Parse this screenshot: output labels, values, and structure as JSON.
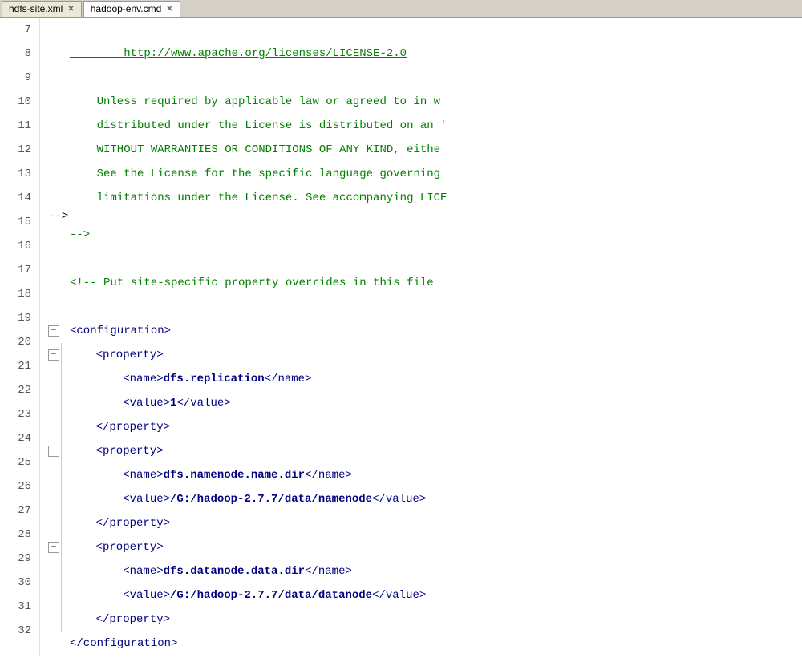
{
  "tabs": [
    {
      "id": "hdfs-site",
      "label": "hdfs-site.xml",
      "active": false,
      "closable": true
    },
    {
      "id": "hadoop-env",
      "label": "hadoop-env.cmd",
      "active": true,
      "closable": true
    }
  ],
  "lines": [
    {
      "num": 7,
      "content": "",
      "type": "empty",
      "indent": 0
    },
    {
      "num": 8,
      "content": "        http://www.apache.org/licenses/LICENSE-2.0",
      "type": "link",
      "indent": 0
    },
    {
      "num": 9,
      "content": "",
      "type": "empty",
      "indent": 0
    },
    {
      "num": 10,
      "content": "    Unless required by applicable law or agreed to in w",
      "type": "comment",
      "indent": 0
    },
    {
      "num": 11,
      "content": "    distributed under the License is distributed on an '",
      "type": "comment",
      "indent": 0
    },
    {
      "num": 12,
      "content": "    WITHOUT WARRANTIES OR CONDITIONS OF ANY KIND, eithe",
      "type": "comment",
      "indent": 0
    },
    {
      "num": 13,
      "content": "    See the License for the specific language governing",
      "type": "comment",
      "indent": 0
    },
    {
      "num": 14,
      "content": "    limitations under the License. See accompanying LICE",
      "type": "comment",
      "indent": 0
    },
    {
      "num": 15,
      "content": "-->",
      "type": "comment",
      "indent": 0
    },
    {
      "num": 16,
      "content": "",
      "type": "empty",
      "indent": 0
    },
    {
      "num": 17,
      "content": "<!-- Put site-specific property overrides in this file",
      "type": "comment",
      "indent": 0
    },
    {
      "num": 18,
      "content": "",
      "type": "empty",
      "indent": 0
    },
    {
      "num": 19,
      "content": "<configuration>",
      "type": "tag-foldable",
      "indent": 0
    },
    {
      "num": 20,
      "content": "    <property>",
      "type": "tag-foldable",
      "indent": 1
    },
    {
      "num": 21,
      "content": "        <name>dfs.replication</name>",
      "type": "tag-with-bold",
      "tag_open": "<name>",
      "bold": "dfs.replication",
      "tag_close": "</name>",
      "indent": 2
    },
    {
      "num": 22,
      "content": "        <value>1</value>",
      "type": "tag-with-bold",
      "tag_open": "<value>",
      "bold": "1",
      "tag_close": "</value>",
      "indent": 2
    },
    {
      "num": 23,
      "content": "    </property>",
      "type": "tag-close",
      "indent": 1
    },
    {
      "num": 24,
      "content": "    <property>",
      "type": "tag-foldable",
      "indent": 1
    },
    {
      "num": 25,
      "content": "        <name>dfs.namenode.name.dir</name>",
      "type": "tag-with-bold",
      "tag_open": "<name>",
      "bold": "dfs.namenode.name.dir",
      "tag_close": "</name>",
      "indent": 2
    },
    {
      "num": 26,
      "content": "        <value>/G:/hadoop-2.7.7/data/namenode</value>",
      "type": "tag-with-bold",
      "tag_open": "<value>",
      "bold": "/G:/hadoop-2.7.7/data/namenode",
      "tag_close": "</value>",
      "indent": 2
    },
    {
      "num": 27,
      "content": "    </property>",
      "type": "tag-close",
      "indent": 1
    },
    {
      "num": 28,
      "content": "    <property>",
      "type": "tag-foldable",
      "indent": 1
    },
    {
      "num": 29,
      "content": "        <name>dfs.datanode.data.dir</name>",
      "type": "tag-with-bold",
      "tag_open": "<name>",
      "bold": "dfs.datanode.data.dir",
      "tag_close": "</name>",
      "indent": 2
    },
    {
      "num": 30,
      "content": "        <value>/G:/hadoop-2.7.7/data/datanode</value>",
      "type": "tag-with-bold",
      "tag_open": "<value>",
      "bold": "/G:/hadoop-2.7.7/data/datanode",
      "tag_close": "</value>",
      "indent": 2
    },
    {
      "num": 31,
      "content": "    </property>",
      "type": "tag-close",
      "indent": 1
    },
    {
      "num": 32,
      "content": "</configuration>",
      "type": "tag-close-main",
      "indent": 0
    }
  ],
  "icons": {
    "close": "✕",
    "fold_minus": "−",
    "fold_plus": "+"
  }
}
